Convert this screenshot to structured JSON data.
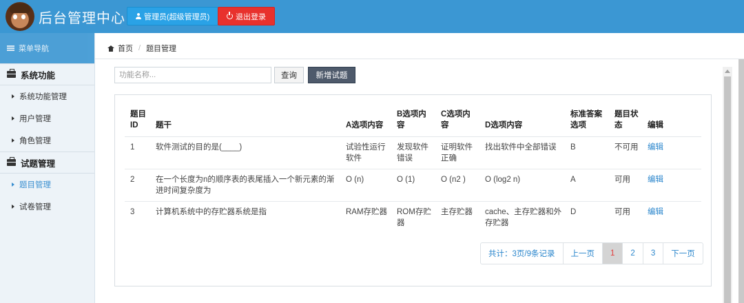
{
  "header": {
    "app_title": "后台管理中心",
    "admin_button": "管理员(超级管理员)",
    "logout_button": "退出登录",
    "colors": {
      "topbar": "#3b97d3",
      "admin_button": "#2aa2e6",
      "logout_button": "#e8312d"
    }
  },
  "sidebar": {
    "nav_header": "菜单导航",
    "groups": [
      {
        "label": "系统功能",
        "items": [
          {
            "label": "系统功能管理"
          },
          {
            "label": "用户管理"
          },
          {
            "label": "角色管理"
          }
        ]
      },
      {
        "label": "试题管理",
        "items": [
          {
            "label": "题目管理",
            "active": true
          },
          {
            "label": "试卷管理"
          }
        ]
      }
    ]
  },
  "breadcrumb": {
    "home": "首页",
    "current": "题目管理"
  },
  "search": {
    "placeholder": "功能名称...",
    "value": "",
    "query_button": "查询",
    "new_button": "新增试题"
  },
  "table": {
    "columns": [
      "题目ID",
      "题干",
      "A选项内容",
      "B选项内容",
      "C选项内容",
      "D选项内容",
      "标准答案选项",
      "题目状态",
      "编辑"
    ],
    "rows": [
      {
        "id": "1",
        "stem": "软件测试的目的是(____)",
        "a": "试验性运行软件",
        "b": "发现软件错误",
        "c": "证明软件正确",
        "d": "找出软件中全部错误",
        "answer": "B",
        "status": "不可用",
        "edit": "编辑"
      },
      {
        "id": "2",
        "stem": "在一个长度为n的顺序表的表尾插入一个新元素的渐进时间复杂度为",
        "a": "O (n)",
        "b": "O (1)",
        "c": "O (n2 )",
        "d": "O (log2 n)",
        "answer": "A",
        "status": "可用",
        "edit": "编辑"
      },
      {
        "id": "3",
        "stem": "计算机系统中的存贮器系统是指",
        "a": "RAM存贮器",
        "b": "ROM存贮器",
        "c": "主存贮器",
        "d": "cache、主存贮器和外存贮器",
        "answer": "D",
        "status": "可用",
        "edit": "编辑"
      }
    ]
  },
  "pagination": {
    "info": "共计：3页/9条记录",
    "prev": "上一页",
    "pages": [
      "1",
      "2",
      "3"
    ],
    "current_page": "1",
    "next": "下一页"
  }
}
